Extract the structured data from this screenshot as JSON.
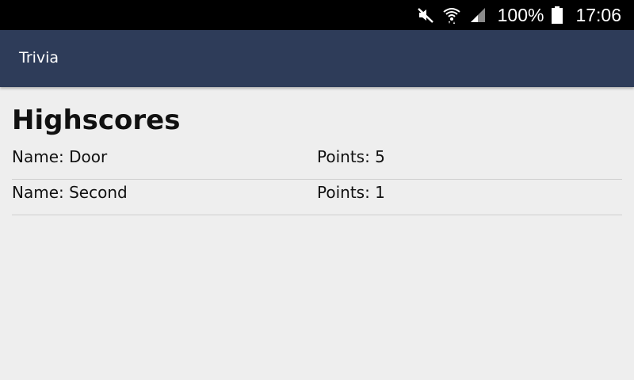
{
  "status_bar": {
    "icons": [
      "mute-icon",
      "wifi-icon",
      "signal-icon",
      "battery-icon"
    ],
    "battery_percent": "100%",
    "time": "17:06"
  },
  "app_bar": {
    "title": "Trivia",
    "background_color": "#2e3c59"
  },
  "page": {
    "title": "Highscores",
    "scores": [
      {
        "name": "Name: Door",
        "points": "Points: 5"
      },
      {
        "name": "Name: Second",
        "points": "Points: 1"
      }
    ]
  }
}
